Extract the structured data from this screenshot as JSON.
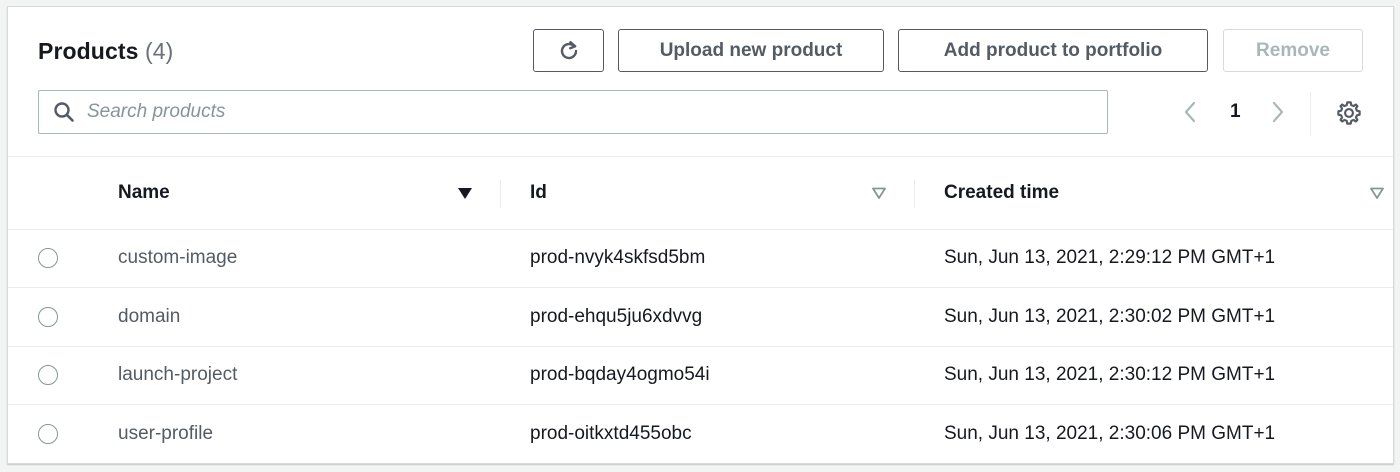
{
  "header": {
    "title": "Products",
    "count": "(4)"
  },
  "toolbar": {
    "refresh_icon": "refresh-icon",
    "upload_label": "Upload new product",
    "add_label": "Add product to portfolio",
    "remove_label": "Remove"
  },
  "search": {
    "placeholder": "Search products",
    "value": ""
  },
  "pagination": {
    "current_page": "1",
    "prev_icon": "chevron-left-icon",
    "next_icon": "chevron-right-icon",
    "settings_icon": "gear-icon"
  },
  "table": {
    "columns": [
      "Name",
      "Id",
      "Created time"
    ],
    "sorted_column": "Name",
    "rows": [
      {
        "name": "custom-image",
        "id": "prod-nvyk4skfsd5bm",
        "created": "Sun, Jun 13, 2021, 2:29:12 PM GMT+1"
      },
      {
        "name": "domain",
        "id": "prod-ehqu5ju6xdvvg",
        "created": "Sun, Jun 13, 2021, 2:30:02 PM GMT+1"
      },
      {
        "name": "launch-project",
        "id": "prod-bqday4ogmo54i",
        "created": "Sun, Jun 13, 2021, 2:30:12 PM GMT+1"
      },
      {
        "name": "user-profile",
        "id": "prod-oitkxtd455obc",
        "created": "Sun, Jun 13, 2021, 2:30:06 PM GMT+1"
      }
    ]
  },
  "colors": {
    "page_bg": "#f2f3f3",
    "panel_bg": "#ffffff",
    "button_border": "#545b64",
    "disabled": "#aab7b8",
    "text": "#16191f"
  }
}
